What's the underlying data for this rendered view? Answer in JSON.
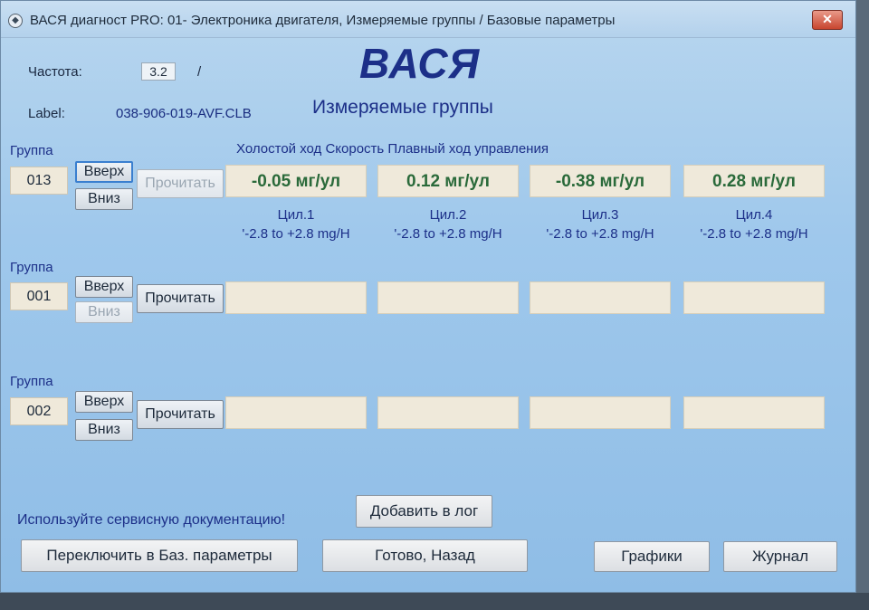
{
  "window": {
    "title": "ВАСЯ диагност PRO: 01- Электроника двигателя,  Измеряемые группы / Базовые параметры",
    "close_label": "✕"
  },
  "header": {
    "frequency_label": "Частота:",
    "frequency_value": "3.2",
    "frequency_separator": "/",
    "brand": "ВАСЯ",
    "subtitle": "Измеряемые группы",
    "label_caption": "Label:",
    "label_value": "038-906-019-AVF.CLB"
  },
  "groups": [
    {
      "label": "Группа",
      "number": "013",
      "up_label": "Вверх",
      "down_label": "Вниз",
      "read_label": "Прочитать",
      "title": "Холостой ход Скорость Плавный ход управления",
      "values": [
        "-0.05 мг/ул",
        "0.12 мг/ул",
        "-0.38 мг/ул",
        "0.28 мг/ул"
      ],
      "names": [
        "Цил.1",
        "Цил.2",
        "Цил.3",
        "Цил.4"
      ],
      "ranges": [
        "'-2.8 to +2.8 mg/H",
        "'-2.8 to +2.8 mg/H",
        "'-2.8 to +2.8 mg/H",
        "'-2.8 to +2.8 mg/H"
      ]
    },
    {
      "label": "Группа",
      "number": "001",
      "up_label": "Вверх",
      "down_label": "Вниз",
      "read_label": "Прочитать"
    },
    {
      "label": "Группа",
      "number": "002",
      "up_label": "Вверх",
      "down_label": "Вниз",
      "read_label": "Прочитать"
    }
  ],
  "footer": {
    "doc_hint": "Используйте сервисную документацию!",
    "add_log_label": "Добавить в лог",
    "switch_basic_label": "Переключить в Баз. параметры",
    "done_back_label": "Готово, Назад",
    "graphs_label": "Графики",
    "journal_label": "Журнал"
  },
  "colors": {
    "window_bg": "#9fc8ec",
    "value_text": "#2a6a3a",
    "heading_text": "#1c2f88",
    "close_button": "#c8452f"
  }
}
